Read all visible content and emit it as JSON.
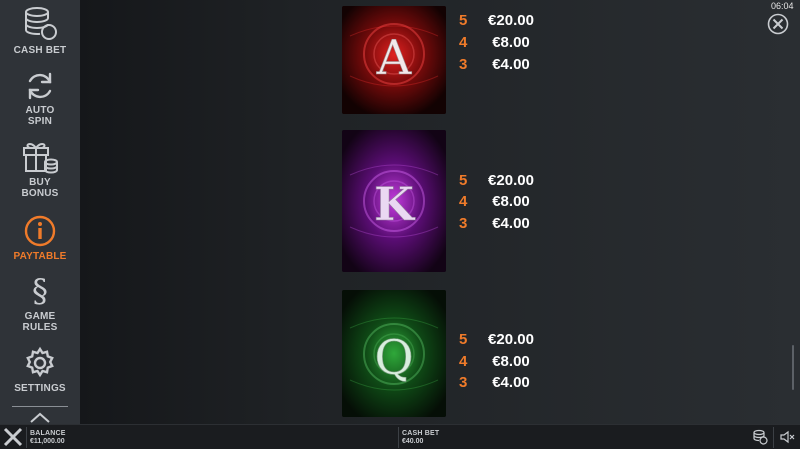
{
  "sidebar": {
    "items": [
      {
        "label": "CASH BET",
        "icon": "coins-icon"
      },
      {
        "label": "AUTO\nSPIN",
        "icon": "refresh-icon"
      },
      {
        "label": "BUY\nBONUS",
        "icon": "gift-icon"
      },
      {
        "label": "PAYTABLE",
        "icon": "info-icon",
        "active": true
      },
      {
        "label": "GAME\nRULES",
        "icon": "section-icon"
      },
      {
        "label": "SETTINGS",
        "icon": "gear-icon"
      }
    ]
  },
  "header": {
    "clock": "06:04"
  },
  "paytable": {
    "symbols": [
      {
        "letter": "A",
        "color": "#c21a1a",
        "payouts": [
          {
            "count": "5",
            "amount": "€20.00"
          },
          {
            "count": "4",
            "amount": "€8.00"
          },
          {
            "count": "3",
            "amount": "€4.00"
          }
        ]
      },
      {
        "letter": "K",
        "color": "#8a1fb0",
        "payouts": [
          {
            "count": "5",
            "amount": "€20.00"
          },
          {
            "count": "4",
            "amount": "€8.00"
          },
          {
            "count": "3",
            "amount": "€4.00"
          }
        ]
      },
      {
        "letter": "Q",
        "color": "#1f7a25",
        "payouts": [
          {
            "count": "5",
            "amount": "€20.00"
          },
          {
            "count": "4",
            "amount": "€8.00"
          },
          {
            "count": "3",
            "amount": "€4.00"
          }
        ]
      }
    ]
  },
  "bottombar": {
    "balance_label": "BALANCE",
    "balance_value": "€11,000.00",
    "cashbet_label": "CASH BET",
    "cashbet_value": "€40.00"
  }
}
